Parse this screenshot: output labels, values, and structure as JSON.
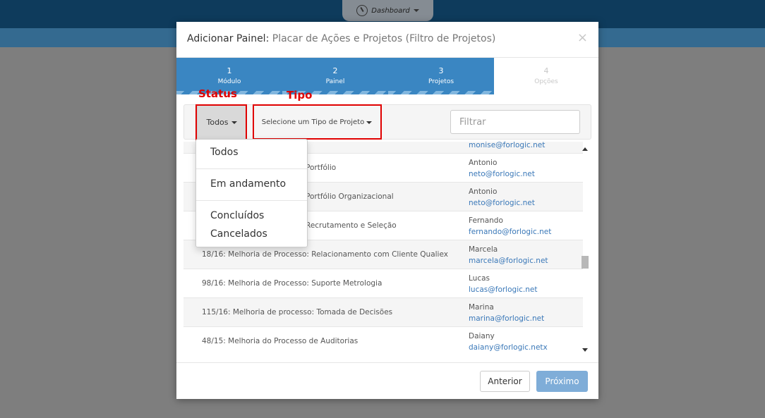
{
  "background": {
    "nav_label": "Dashboard"
  },
  "modal": {
    "title": "Adicionar Painel:",
    "subtitle": "Placar de Ações e Projetos (Filtro de Projetos)",
    "close": "×"
  },
  "wizard": {
    "steps": [
      {
        "num": "1",
        "label": "Módulo",
        "state": "done"
      },
      {
        "num": "2",
        "label": "Painel",
        "state": "done"
      },
      {
        "num": "3",
        "label": "Projetos",
        "state": "current"
      },
      {
        "num": "4",
        "label": "Opções",
        "state": "pending"
      }
    ]
  },
  "filters": {
    "status_label": "Todos",
    "tipo_label": "Selecione um Tipo de Projeto",
    "search_placeholder": "Filtrar"
  },
  "annotations": {
    "status": "Status",
    "tipo": "Tipo"
  },
  "status_dropdown": {
    "options": [
      "Todos",
      "Em andamento",
      "Concluídos",
      "Cancelados"
    ]
  },
  "rows": [
    {
      "name": "",
      "user": "",
      "email": "monise@forlogic.net"
    },
    {
      "name": "Portfólio",
      "user": "Antonio",
      "email": "neto@forlogic.net"
    },
    {
      "name": "Portfólio Organizacional",
      "user": "Antonio",
      "email": "neto@forlogic.net"
    },
    {
      "name": "Recrutamento e Seleção",
      "user": "Fernando",
      "email": "fernando@forlogic.net"
    },
    {
      "name": "18/16: Melhoria de Processo: Relacionamento com Cliente Qualiex",
      "user": "Marcela",
      "email": "marcela@forlogic.net"
    },
    {
      "name": "98/16: Melhoria de Processo: Suporte Metrologia",
      "user": "Lucas",
      "email": "lucas@forlogic.net"
    },
    {
      "name": "115/16: Melhoria de processo: Tomada de Decisões",
      "user": "Marina",
      "email": "marina@forlogic.net"
    },
    {
      "name": "48/15: Melhoria do Processo de Auditorias",
      "user": "Daiany",
      "email": "daiany@forlogic.netx"
    }
  ],
  "footer": {
    "prev_label": "Anterior",
    "next_label": "Próximo"
  },
  "colors": {
    "wizard_blue": "#3a86c2",
    "link_blue": "#3a78b8",
    "annotation_red": "#e00000",
    "next_button": "#7fadd8"
  }
}
